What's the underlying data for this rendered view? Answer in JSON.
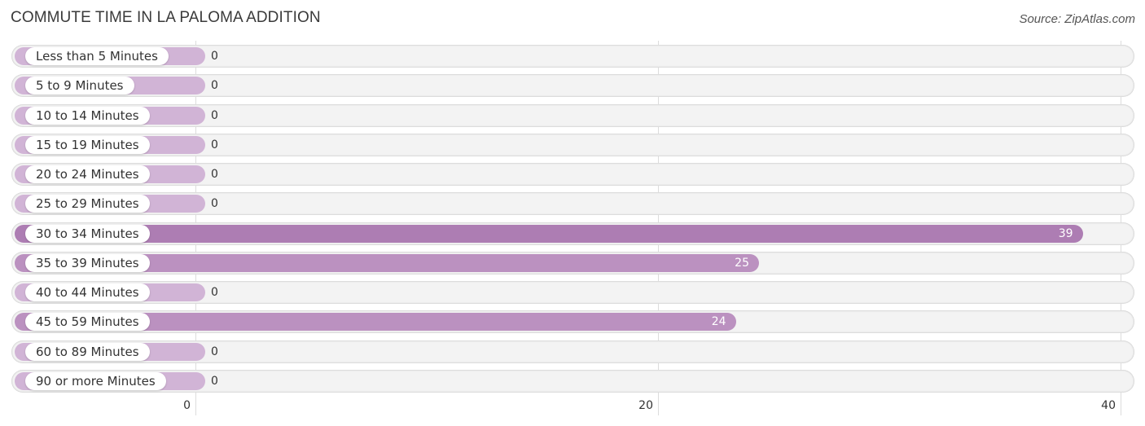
{
  "header": {
    "title": "COMMUTE TIME IN LA PALOMA ADDITION",
    "source": "Source: ZipAtlas.com"
  },
  "colors": {
    "bar_strong": "#ad7db3",
    "bar_medium": "#bb91c0",
    "bar_zero": "#d1b4d6",
    "row_background": "#f3f3f3"
  },
  "chart_data": {
    "type": "bar",
    "orientation": "horizontal",
    "title": "COMMUTE TIME IN LA PALOMA ADDITION",
    "xlabel": "",
    "ylabel": "",
    "xlim": [
      0,
      40
    ],
    "x_ticks": [
      "0",
      "20",
      "40"
    ],
    "grid": true,
    "categories": [
      "Less than 5 Minutes",
      "5 to 9 Minutes",
      "10 to 14 Minutes",
      "15 to 19 Minutes",
      "20 to 24 Minutes",
      "25 to 29 Minutes",
      "30 to 34 Minutes",
      "35 to 39 Minutes",
      "40 to 44 Minutes",
      "45 to 59 Minutes",
      "60 to 89 Minutes",
      "90 or more Minutes"
    ],
    "values": [
      0,
      0,
      0,
      0,
      0,
      0,
      39,
      25,
      0,
      24,
      0,
      0
    ],
    "value_labels": [
      "0",
      "0",
      "0",
      "0",
      "0",
      "0",
      "39",
      "25",
      "0",
      "24",
      "0",
      "0"
    ]
  }
}
